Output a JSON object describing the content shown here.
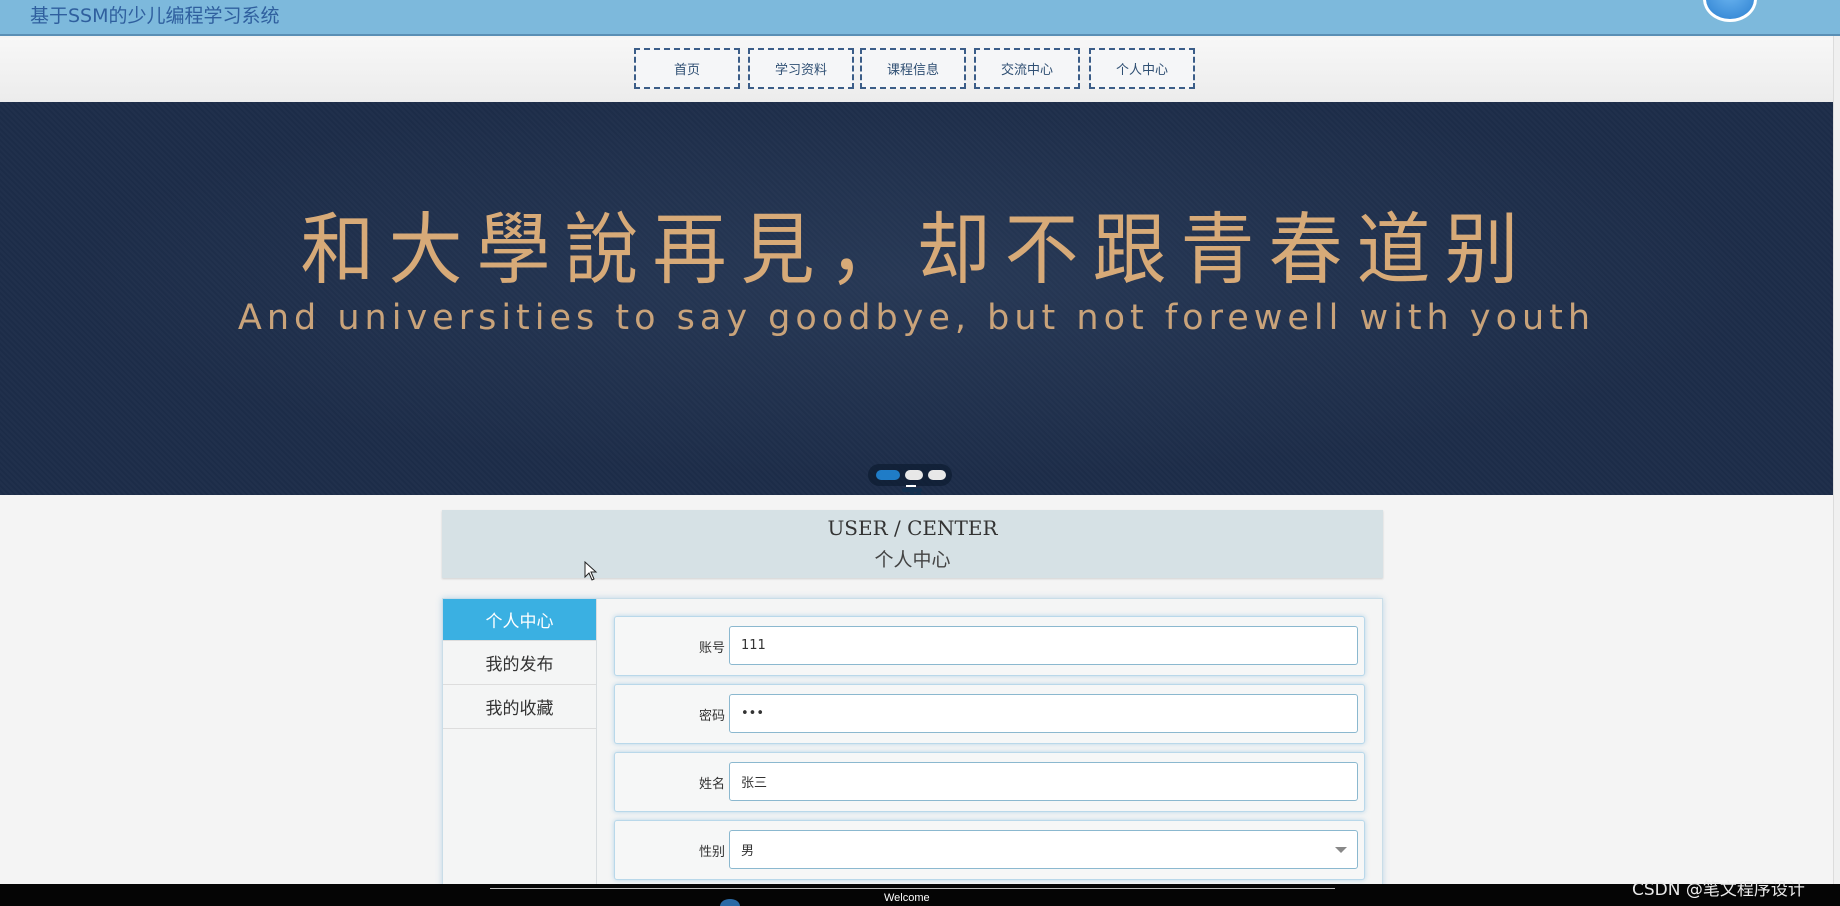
{
  "header": {
    "site_title": "基于SSM的少儿编程学习系统"
  },
  "nav": {
    "items": [
      {
        "label": "首页"
      },
      {
        "label": "学习资料"
      },
      {
        "label": "课程信息"
      },
      {
        "label": "交流中心"
      },
      {
        "label": "个人中心"
      }
    ]
  },
  "banner": {
    "headline_cn": "和大學說再見，却不跟青春道别",
    "headline_en": "And universities to say goodbye, but not forewell with youth",
    "active_slide": 1,
    "slide_count": 3
  },
  "section": {
    "title_en": "USER / CENTER",
    "title_cn": "个人中心"
  },
  "side_menu": {
    "items": [
      {
        "label": "个人中心",
        "active": true
      },
      {
        "label": "我的发布",
        "active": false
      },
      {
        "label": "我的收藏",
        "active": false
      }
    ]
  },
  "form": {
    "fields": [
      {
        "label": "账号",
        "value": "111"
      },
      {
        "label": "密码",
        "value": "•••"
      },
      {
        "label": "姓名",
        "value": "张三"
      },
      {
        "label": "性别",
        "value": "男"
      }
    ]
  },
  "footer": {
    "welcome": "Welcome",
    "watermark": "CSDN @笔文程序设计"
  },
  "colors": {
    "header_bg": "#7db9dc",
    "banner_bg": "#1d2d49",
    "accent": "#3ab0e2",
    "banner_text": "#d7aa78"
  }
}
